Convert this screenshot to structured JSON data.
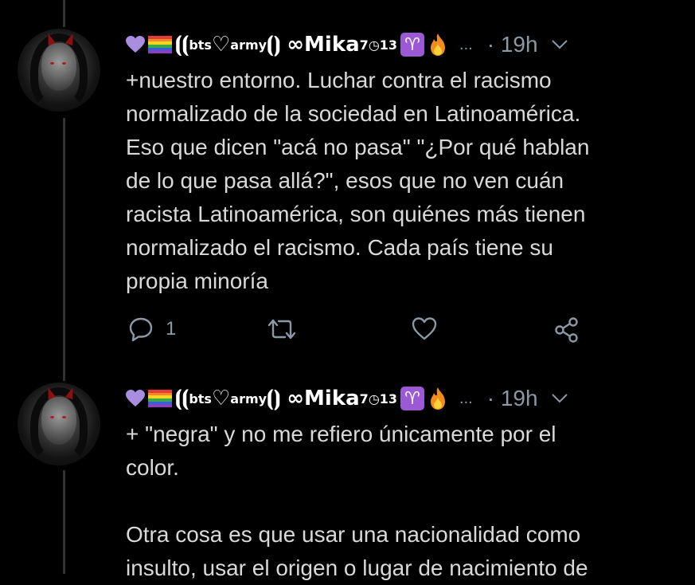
{
  "tweets": [
    {
      "author": {
        "name_bts": "bts",
        "name_army": "army",
        "name_mika": "∞Mika",
        "name_sup7": "7",
        "name_sub13": "13"
      },
      "ellipsis": "...",
      "time": "· 19h",
      "text": "+nuestro entorno. Luchar contra el racismo\nnormalizado de la sociedad en Latinoamérica.\nEso que dicen \"acá no pasa\" \"¿Por qué hablan\nde lo que pasa allá?\", esos que no ven cuán\nracista Latinoamérica, son quiénes más tienen\nnormalizado el racismo. Cada país tiene su\npropia minoría",
      "reply_count": "1"
    },
    {
      "author": {
        "name_bts": "bts",
        "name_army": "army",
        "name_mika": "∞Mika",
        "name_sup7": "7",
        "name_sub13": "13"
      },
      "ellipsis": "...",
      "time": "· 19h",
      "text": "+ \"negra\" y no me refiero únicamente por el\ncolor.\n\nOtra cosa es que usar una nacionalidad como\ninsulto, usar el origen o lugar de nacimiento de"
    }
  ],
  "icons": {
    "reply": "reply-icon",
    "retweet": "retweet-icon",
    "like": "heart-icon",
    "share": "share-icon",
    "more": "chevron-down-icon"
  },
  "colors": {
    "background": "#000000",
    "text": "#d9d9d9",
    "muted": "#8b98a5",
    "thread_line": "#2f3336"
  }
}
